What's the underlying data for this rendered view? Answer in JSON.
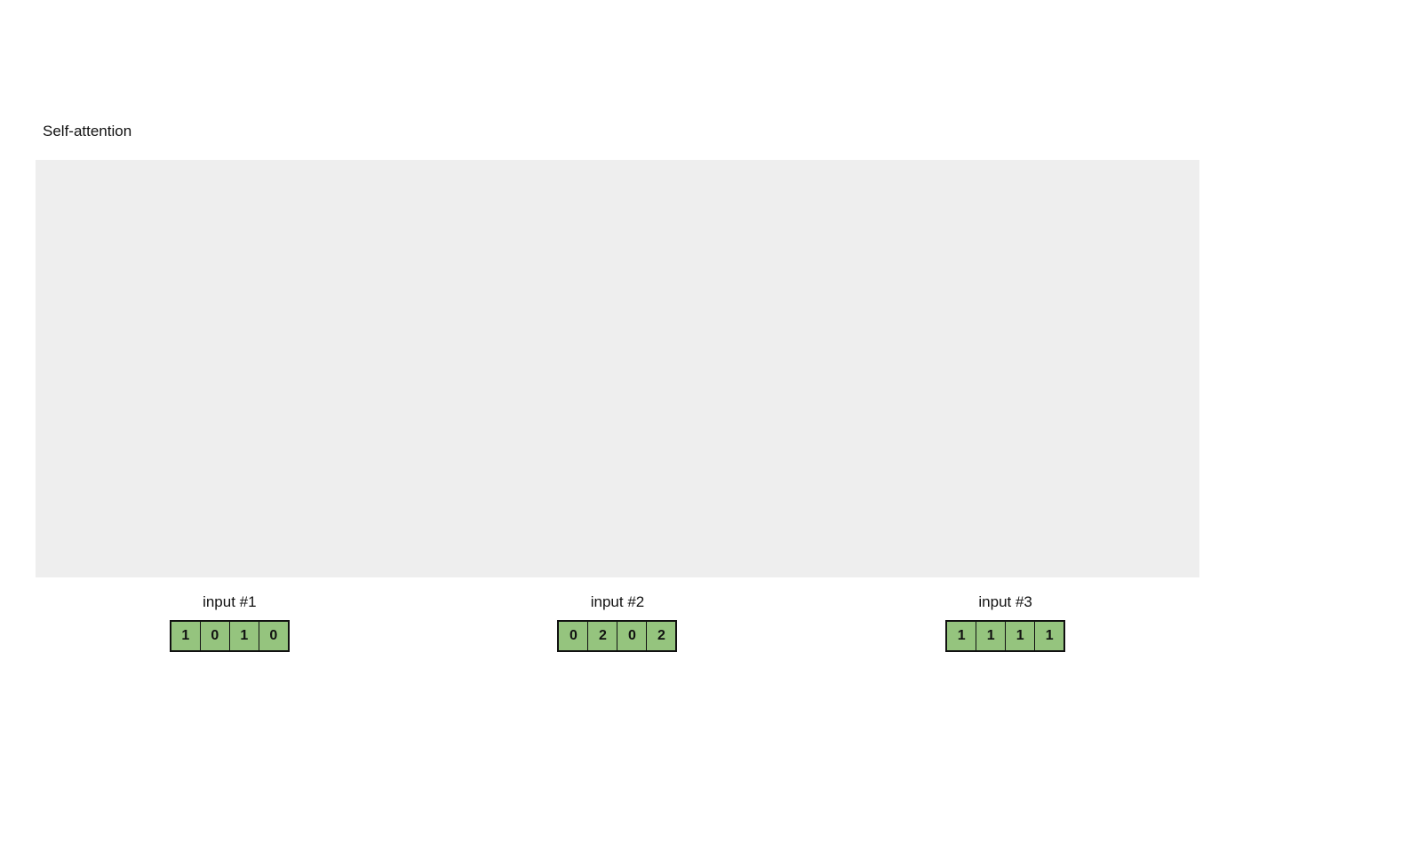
{
  "title": "Self-attention",
  "inputs": [
    {
      "label": "input #1",
      "values": [
        "1",
        "0",
        "1",
        "0"
      ]
    },
    {
      "label": "input #2",
      "values": [
        "0",
        "2",
        "0",
        "2"
      ]
    },
    {
      "label": "input #3",
      "values": [
        "1",
        "1",
        "1",
        "1"
      ]
    }
  ],
  "colors": {
    "cell_fill": "#95c47e",
    "gray_bg": "#eeeeee"
  }
}
